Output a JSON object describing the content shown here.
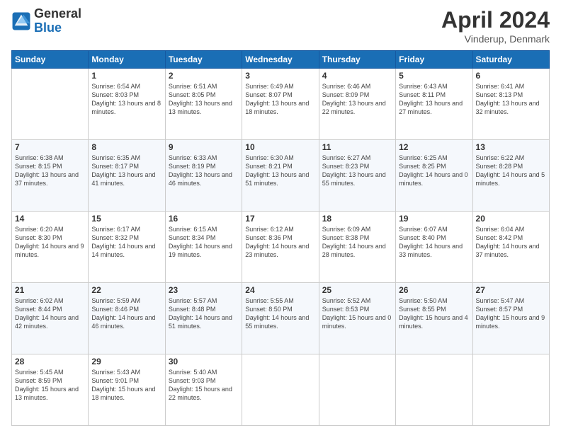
{
  "header": {
    "logo_line1": "General",
    "logo_line2": "Blue",
    "month": "April 2024",
    "location": "Vinderup, Denmark"
  },
  "weekdays": [
    "Sunday",
    "Monday",
    "Tuesday",
    "Wednesday",
    "Thursday",
    "Friday",
    "Saturday"
  ],
  "weeks": [
    [
      {
        "day": "",
        "sunrise": "",
        "sunset": "",
        "daylight": ""
      },
      {
        "day": "1",
        "sunrise": "Sunrise: 6:54 AM",
        "sunset": "Sunset: 8:03 PM",
        "daylight": "Daylight: 13 hours and 8 minutes."
      },
      {
        "day": "2",
        "sunrise": "Sunrise: 6:51 AM",
        "sunset": "Sunset: 8:05 PM",
        "daylight": "Daylight: 13 hours and 13 minutes."
      },
      {
        "day": "3",
        "sunrise": "Sunrise: 6:49 AM",
        "sunset": "Sunset: 8:07 PM",
        "daylight": "Daylight: 13 hours and 18 minutes."
      },
      {
        "day": "4",
        "sunrise": "Sunrise: 6:46 AM",
        "sunset": "Sunset: 8:09 PM",
        "daylight": "Daylight: 13 hours and 22 minutes."
      },
      {
        "day": "5",
        "sunrise": "Sunrise: 6:43 AM",
        "sunset": "Sunset: 8:11 PM",
        "daylight": "Daylight: 13 hours and 27 minutes."
      },
      {
        "day": "6",
        "sunrise": "Sunrise: 6:41 AM",
        "sunset": "Sunset: 8:13 PM",
        "daylight": "Daylight: 13 hours and 32 minutes."
      }
    ],
    [
      {
        "day": "7",
        "sunrise": "Sunrise: 6:38 AM",
        "sunset": "Sunset: 8:15 PM",
        "daylight": "Daylight: 13 hours and 37 minutes."
      },
      {
        "day": "8",
        "sunrise": "Sunrise: 6:35 AM",
        "sunset": "Sunset: 8:17 PM",
        "daylight": "Daylight: 13 hours and 41 minutes."
      },
      {
        "day": "9",
        "sunrise": "Sunrise: 6:33 AM",
        "sunset": "Sunset: 8:19 PM",
        "daylight": "Daylight: 13 hours and 46 minutes."
      },
      {
        "day": "10",
        "sunrise": "Sunrise: 6:30 AM",
        "sunset": "Sunset: 8:21 PM",
        "daylight": "Daylight: 13 hours and 51 minutes."
      },
      {
        "day": "11",
        "sunrise": "Sunrise: 6:27 AM",
        "sunset": "Sunset: 8:23 PM",
        "daylight": "Daylight: 13 hours and 55 minutes."
      },
      {
        "day": "12",
        "sunrise": "Sunrise: 6:25 AM",
        "sunset": "Sunset: 8:25 PM",
        "daylight": "Daylight: 14 hours and 0 minutes."
      },
      {
        "day": "13",
        "sunrise": "Sunrise: 6:22 AM",
        "sunset": "Sunset: 8:28 PM",
        "daylight": "Daylight: 14 hours and 5 minutes."
      }
    ],
    [
      {
        "day": "14",
        "sunrise": "Sunrise: 6:20 AM",
        "sunset": "Sunset: 8:30 PM",
        "daylight": "Daylight: 14 hours and 9 minutes."
      },
      {
        "day": "15",
        "sunrise": "Sunrise: 6:17 AM",
        "sunset": "Sunset: 8:32 PM",
        "daylight": "Daylight: 14 hours and 14 minutes."
      },
      {
        "day": "16",
        "sunrise": "Sunrise: 6:15 AM",
        "sunset": "Sunset: 8:34 PM",
        "daylight": "Daylight: 14 hours and 19 minutes."
      },
      {
        "day": "17",
        "sunrise": "Sunrise: 6:12 AM",
        "sunset": "Sunset: 8:36 PM",
        "daylight": "Daylight: 14 hours and 23 minutes."
      },
      {
        "day": "18",
        "sunrise": "Sunrise: 6:09 AM",
        "sunset": "Sunset: 8:38 PM",
        "daylight": "Daylight: 14 hours and 28 minutes."
      },
      {
        "day": "19",
        "sunrise": "Sunrise: 6:07 AM",
        "sunset": "Sunset: 8:40 PM",
        "daylight": "Daylight: 14 hours and 33 minutes."
      },
      {
        "day": "20",
        "sunrise": "Sunrise: 6:04 AM",
        "sunset": "Sunset: 8:42 PM",
        "daylight": "Daylight: 14 hours and 37 minutes."
      }
    ],
    [
      {
        "day": "21",
        "sunrise": "Sunrise: 6:02 AM",
        "sunset": "Sunset: 8:44 PM",
        "daylight": "Daylight: 14 hours and 42 minutes."
      },
      {
        "day": "22",
        "sunrise": "Sunrise: 5:59 AM",
        "sunset": "Sunset: 8:46 PM",
        "daylight": "Daylight: 14 hours and 46 minutes."
      },
      {
        "day": "23",
        "sunrise": "Sunrise: 5:57 AM",
        "sunset": "Sunset: 8:48 PM",
        "daylight": "Daylight: 14 hours and 51 minutes."
      },
      {
        "day": "24",
        "sunrise": "Sunrise: 5:55 AM",
        "sunset": "Sunset: 8:50 PM",
        "daylight": "Daylight: 14 hours and 55 minutes."
      },
      {
        "day": "25",
        "sunrise": "Sunrise: 5:52 AM",
        "sunset": "Sunset: 8:53 PM",
        "daylight": "Daylight: 15 hours and 0 minutes."
      },
      {
        "day": "26",
        "sunrise": "Sunrise: 5:50 AM",
        "sunset": "Sunset: 8:55 PM",
        "daylight": "Daylight: 15 hours and 4 minutes."
      },
      {
        "day": "27",
        "sunrise": "Sunrise: 5:47 AM",
        "sunset": "Sunset: 8:57 PM",
        "daylight": "Daylight: 15 hours and 9 minutes."
      }
    ],
    [
      {
        "day": "28",
        "sunrise": "Sunrise: 5:45 AM",
        "sunset": "Sunset: 8:59 PM",
        "daylight": "Daylight: 15 hours and 13 minutes."
      },
      {
        "day": "29",
        "sunrise": "Sunrise: 5:43 AM",
        "sunset": "Sunset: 9:01 PM",
        "daylight": "Daylight: 15 hours and 18 minutes."
      },
      {
        "day": "30",
        "sunrise": "Sunrise: 5:40 AM",
        "sunset": "Sunset: 9:03 PM",
        "daylight": "Daylight: 15 hours and 22 minutes."
      },
      {
        "day": "",
        "sunrise": "",
        "sunset": "",
        "daylight": ""
      },
      {
        "day": "",
        "sunrise": "",
        "sunset": "",
        "daylight": ""
      },
      {
        "day": "",
        "sunrise": "",
        "sunset": "",
        "daylight": ""
      },
      {
        "day": "",
        "sunrise": "",
        "sunset": "",
        "daylight": ""
      }
    ]
  ]
}
